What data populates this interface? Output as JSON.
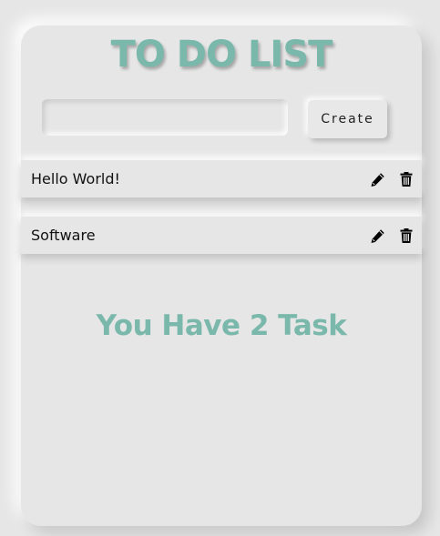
{
  "app": {
    "title": "TO DO LIST"
  },
  "form": {
    "input_value": "",
    "input_placeholder": "",
    "create_label": "Create"
  },
  "tasks": [
    {
      "text": "Hello World!",
      "edit_icon": "pencil-icon",
      "delete_icon": "trash-icon"
    },
    {
      "text": "Software",
      "edit_icon": "pencil-icon",
      "delete_icon": "trash-icon"
    }
  ],
  "summary": {
    "count_text": "You Have 2 Task"
  },
  "colors": {
    "accent": "#7ab8ac",
    "background": "#e6e6e6"
  }
}
